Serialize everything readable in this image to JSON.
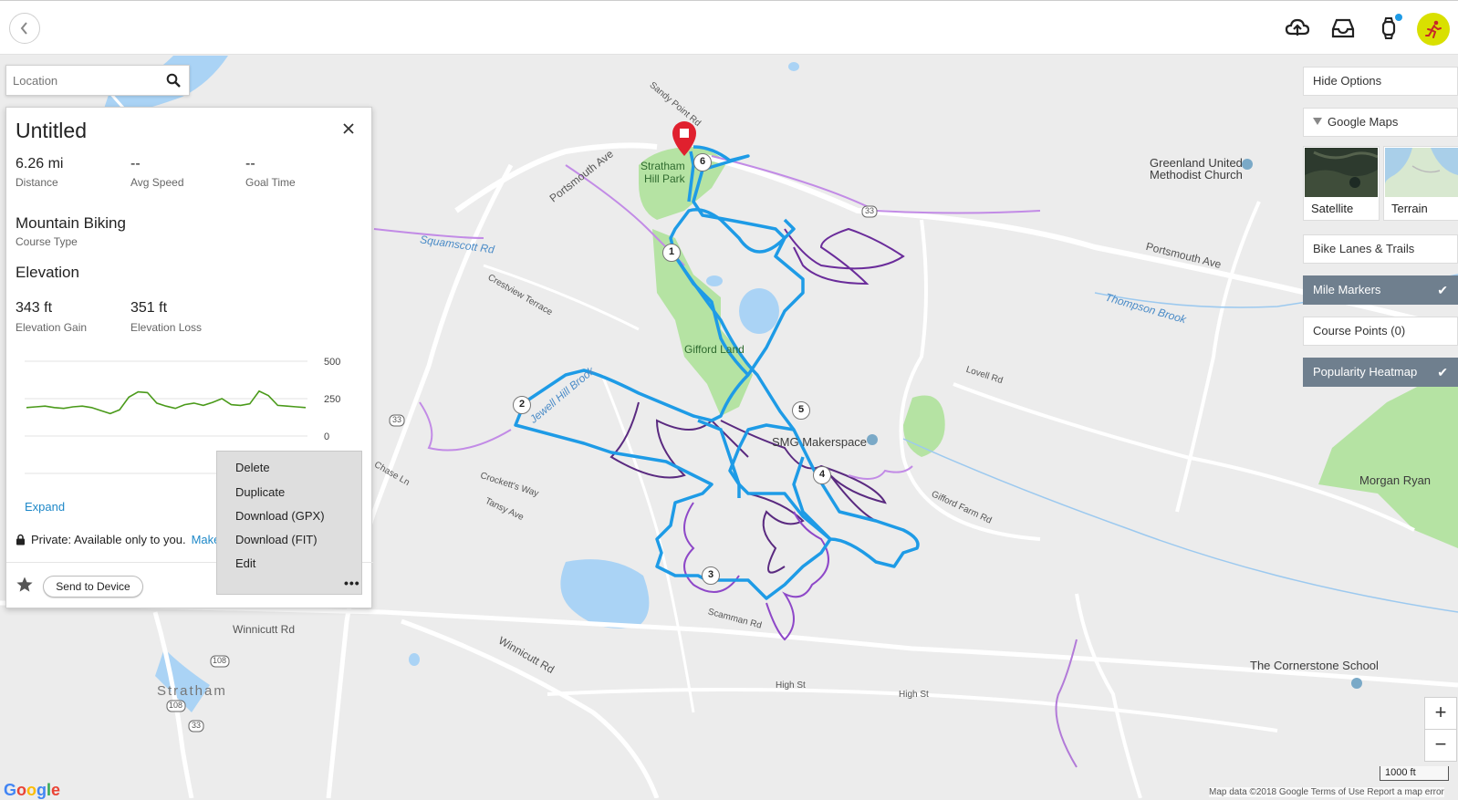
{
  "header": {
    "back_icon": "chevron-left-icon",
    "upload_icon": "cloud-upload-icon",
    "inbox_icon": "inbox-icon",
    "watch_icon": "watch-icon",
    "avatar_icon": "runner-icon"
  },
  "search": {
    "placeholder": "Location"
  },
  "course": {
    "title": "Untitled",
    "distance": {
      "value": "6.26 mi",
      "label": "Distance"
    },
    "avg_speed": {
      "value": "--",
      "label": "Avg Speed"
    },
    "goal_time": {
      "value": "--",
      "label": "Goal Time"
    },
    "course_type": {
      "value": "Mountain Biking",
      "label": "Course Type"
    },
    "elevation_heading": "Elevation",
    "elevation_gain": {
      "value": "343 ft",
      "label": "Elevation Gain"
    },
    "elevation_loss": {
      "value": "351 ft",
      "label": "Elevation Loss"
    },
    "expand_label": "Expand",
    "privacy_text": "Private: Available only to you.",
    "make_link": "Make",
    "send_label": "Send to Device"
  },
  "elevation_chart": {
    "y_ticks": [
      "500",
      "250",
      "0"
    ],
    "ylim": [
      0,
      500
    ],
    "values": [
      190,
      195,
      200,
      190,
      185,
      195,
      200,
      190,
      170,
      150,
      175,
      260,
      295,
      290,
      220,
      200,
      185,
      210,
      220,
      205,
      225,
      250,
      210,
      205,
      215,
      300,
      270,
      205,
      200,
      195,
      190
    ],
    "line_color": "#4a9a1a"
  },
  "context_menu": {
    "items": [
      "Delete",
      "Duplicate",
      "Download (GPX)",
      "Download (FIT)",
      "Edit"
    ],
    "more": "•••"
  },
  "options": {
    "hide_options": "Hide Options",
    "google_maps": "Google Maps",
    "satellite": "Satellite",
    "terrain": "Terrain",
    "bike_lanes": "Bike Lanes & Trails",
    "mile_markers": "Mile Markers",
    "course_points": "Course Points (0)",
    "heatmap": "Popularity Heatmap",
    "check": "✔"
  },
  "map": {
    "labels": {
      "stratham_hill_park_1": "Stratham",
      "stratham_hill_park_2": "Hill Park",
      "gifford_land": "Gifford Land",
      "smg_makerspace": "SMG Makerspace",
      "greenland_church_1": "Greenland United",
      "greenland_church_2": "Methodist Church",
      "portsmouth_ave_1": "Portsmouth Ave",
      "portsmouth_ave_2": "Portsmouth Ave",
      "squamscott_rd": "Squamscott Rd",
      "thompson_brook": "Thompson Brook",
      "jewell_hill_brook": "Jewell Hill Brook",
      "lovell_rd": "Lovell Rd",
      "winnicutt_rd_1": "Winnicutt Rd",
      "winnicutt_rd_2": "Winnicutt Rd",
      "high_st_1": "High St",
      "high_st_2": "High St",
      "stratham": "Stratham",
      "morgan_ryan": "Morgan Ryan",
      "cornerstone_school": "The Cornerstone School",
      "gifford_farm_rd": "Gifford Farm Rd",
      "crestview_terrace": "Crestview Terrace",
      "chase_ln": "Chase Ln",
      "tansy_ave": "Tansy Ave",
      "crocketts_way": "Crockett's Way",
      "scamman_rd": "Scamman Rd",
      "sandy_point_rd": "Sandy Point Rd",
      "route_33": "33",
      "route_108": "108"
    },
    "mile_markers": [
      "1",
      "2",
      "3",
      "4",
      "5",
      "6"
    ],
    "zoom_in": "+",
    "zoom_out": "−",
    "scale": "1000 ft",
    "attribution": "Map data ©2018 Google   Terms of Use   Report a map error",
    "google_logo": "Google",
    "route_color": "#1e9be6",
    "heatmap_color": "#7a3fb8"
  }
}
